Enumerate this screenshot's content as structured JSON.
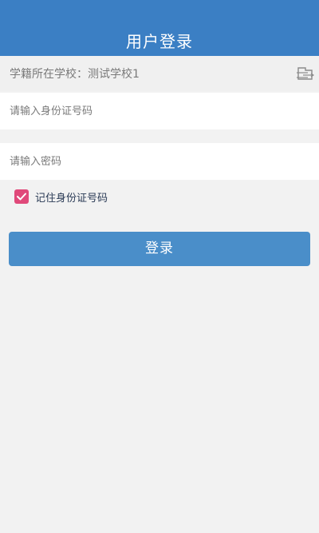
{
  "header": {
    "title": "用户登录"
  },
  "school": {
    "label": "学籍所在学校：测试学校1",
    "switch_icon": "school-switch-icon"
  },
  "form": {
    "id_placeholder": "请输入身份证号码",
    "id_value": "",
    "password_placeholder": "请输入密码",
    "password_value": "",
    "remember_label": "记住身份证号码",
    "remember_checked": true,
    "login_label": "登录"
  },
  "colors": {
    "header": "#3b7fc4",
    "button": "#4a8ec9",
    "checkbox": "#e0497a",
    "background": "#f2f2f2"
  }
}
